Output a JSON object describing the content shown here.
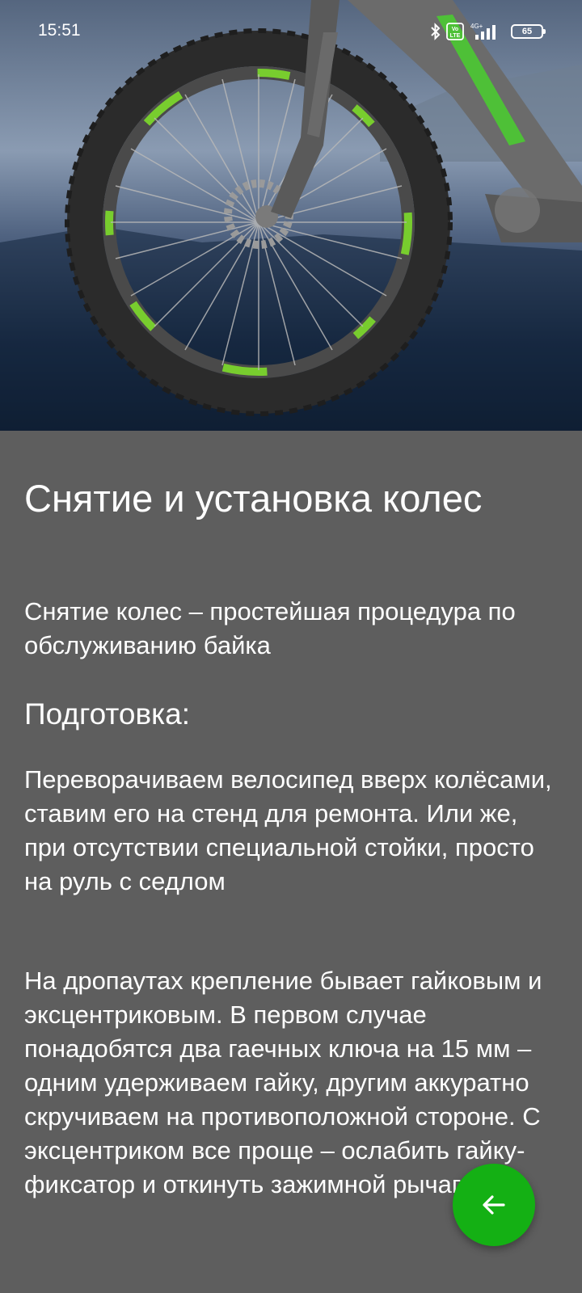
{
  "status_bar": {
    "time": "15:51",
    "volte_label": "Vo LTE",
    "network_label": "4G+",
    "battery_level": "65"
  },
  "hero": {
    "icon": "bike-wheel-image"
  },
  "article": {
    "title": "Снятие и установка колес",
    "lead": "Снятие колес – простейшая процедура по обслуживанию байка",
    "section_title": "Подготовка:",
    "paragraph_1": "Переворачиваем велосипед вверх колёсами, ставим его на стенд для ремонта. Или же, при отсутствии специальной стойки, просто на руль с седлом",
    "paragraph_2": "На дропаутах крепление бывает гайковым и эксцентриковым. В первом случае понадобятся два гаечных ключа на 15 мм – одним удерживаем гайку, другим аккуратно скручиваем на противоположной стороне. С эксцентриком все проще – ослабить гайку-фиксатор и откинуть зажимной рычаг."
  },
  "fab": {
    "icon": "arrow-left-icon",
    "color": "#14b014"
  }
}
